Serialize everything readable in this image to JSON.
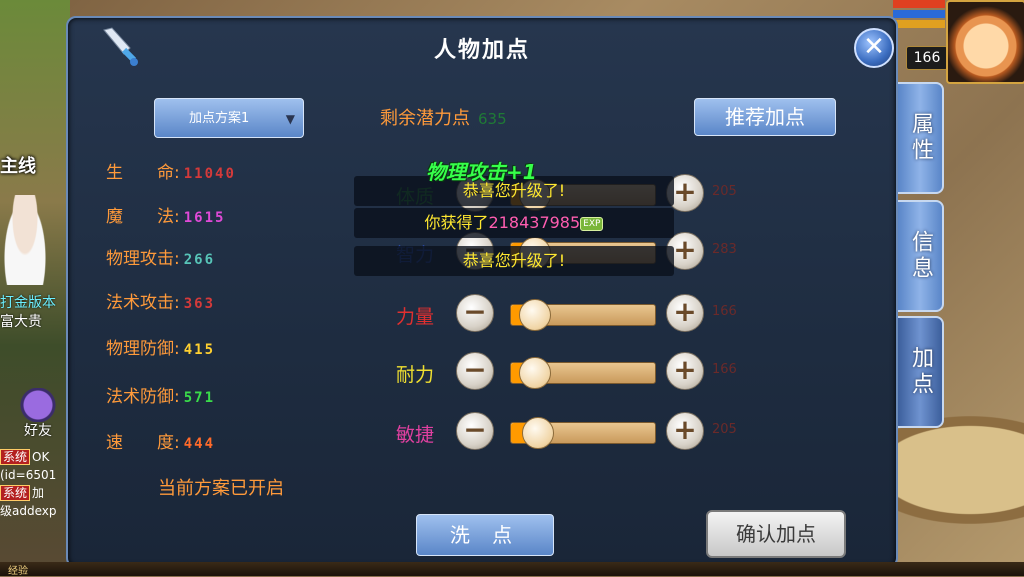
{
  "panel": {
    "title": "人物加点",
    "close_glyph": "✕",
    "scheme_label": "加点方案1",
    "scheme_arrow": "▼",
    "scheme_status": "当前方案已开启"
  },
  "stats": [
    {
      "label": "生　　命:",
      "value": "11040",
      "color": "#d43a3a"
    },
    {
      "label": "魔　　法:",
      "value": "1615",
      "color": "#e04ad8"
    },
    {
      "label": "物理攻击:",
      "value": "266",
      "color": "#57c4b8"
    },
    {
      "label": "法术攻击:",
      "value": "363",
      "color": "#d43a3a"
    },
    {
      "label": "物理防御:",
      "value": "415",
      "color": "#ffd030"
    },
    {
      "label": "法术防御:",
      "value": "571",
      "color": "#3adc4a"
    },
    {
      "label": "速　　度:",
      "value": "444",
      "color": "#ff6a2a"
    }
  ],
  "potential": {
    "label": "剩余潜力点",
    "value": "635"
  },
  "recommend_label": "推荐加点",
  "attributes": [
    {
      "name": "体质",
      "name_color": "#2a8a3a",
      "value": "205",
      "level": 0.1
    },
    {
      "name": "智力",
      "name_color": "#2a4aa8",
      "value": "283",
      "level": 0.1
    },
    {
      "name": "力量",
      "name_color": "#e03030",
      "value": "166",
      "level": 0.1
    },
    {
      "name": "耐力",
      "name_color": "#f0e030",
      "value": "166",
      "level": 0.1
    },
    {
      "name": "敏捷",
      "name_color": "#e040a0",
      "value": "205",
      "level": 0.12
    }
  ],
  "controls": {
    "minus": "−",
    "plus": "+"
  },
  "notifications": {
    "float_text": "物理攻击+1",
    "toast1": "恭喜您升级了!",
    "toast2_prefix": "你获得了",
    "toast2_number": "218437985",
    "toast2_badge": "EXP",
    "toast3": "恭喜您升级了!"
  },
  "buttons": {
    "wash": "洗 点",
    "confirm": "确认加点"
  },
  "side_tabs": [
    "属性",
    "信息",
    "加点"
  ],
  "hud": {
    "level": "166",
    "main_line": "主线",
    "npc_line1": "打金版本",
    "npc_line2": "富大贵",
    "friend": "好友",
    "chat": [
      {
        "tag": "系统",
        "text": "OK"
      },
      {
        "tag": "",
        "text": "(id=6501"
      },
      {
        "tag": "系统",
        "text": "加"
      },
      {
        "tag": "",
        "text": "级addexp"
      }
    ],
    "exp_label": "经验"
  }
}
